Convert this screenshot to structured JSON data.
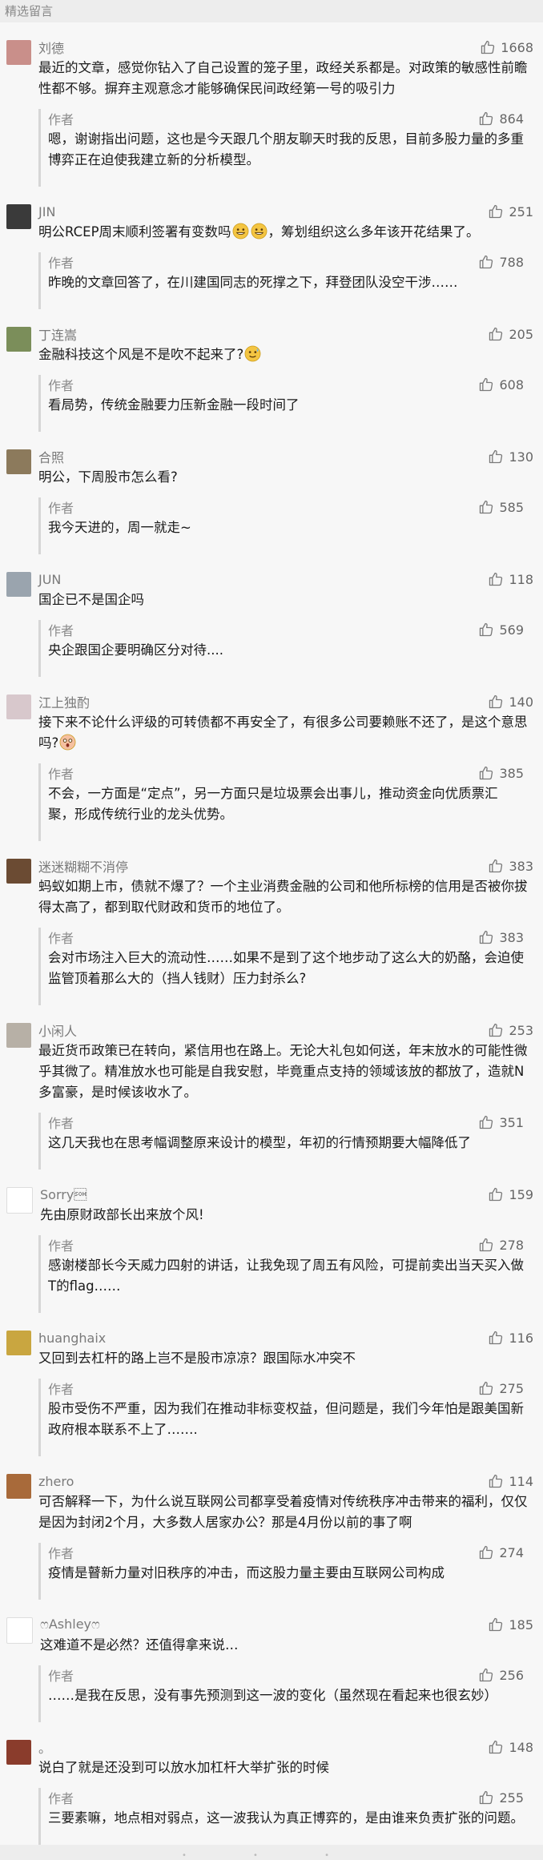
{
  "section_title": "精选留言",
  "comments": [
    {
      "nick": "刘德",
      "likes": "1668",
      "text": "最近的文章，感觉你钻入了自己设置的笼子里，政经关系都是。对政策的敏感性前瞻性都不够。摒弃主观意念才能够确保民间政经第一号的吸引力",
      "avatar_color": "#c98f8a",
      "reply": {
        "author": "作者",
        "likes": "864",
        "text": "嗯，谢谢指出问题，这也是今天跟几个朋友聊天时我的反思，目前多股力量的多重博弈正在迫使我建立新的分析模型。"
      }
    },
    {
      "nick": "JIN",
      "likes": "251",
      "text_before": "明公RCEP周末顺利签署有变数吗",
      "text_after": "，筹划组织这么多年该开花结果了。",
      "emoji": "grin-icon",
      "emoji_count": 2,
      "avatar_color": "#3a3a3a",
      "reply": {
        "author": "作者",
        "likes": "788",
        "text": "昨晚的文章回答了，在川建国同志的死撑之下，拜登团队没空干涉……"
      }
    },
    {
      "nick": "丁连嵩",
      "likes": "205",
      "text_before": "金融科技这个风是不是吹不起来了?",
      "text_after": "",
      "emoji": "sweat-icon",
      "emoji_count": 1,
      "avatar_color": "#7b8e5a",
      "reply": {
        "author": "作者",
        "likes": "608",
        "text": "看局势，传统金融要力压新金融一段时间了"
      }
    },
    {
      "nick": "合照",
      "likes": "130",
      "text": "明公，下周股市怎么看?",
      "avatar_color": "#8c7a5c",
      "reply": {
        "author": "作者",
        "likes": "585",
        "text": "我今天进的，周一就走~"
      }
    },
    {
      "nick": "JUN",
      "likes": "118",
      "text": "国企已不是国企吗",
      "avatar_color": "#9aa4ae",
      "reply": {
        "author": "作者",
        "likes": "569",
        "text": "央企跟国企要明确区分对待...."
      }
    },
    {
      "nick": "江上独酌",
      "likes": "140",
      "text_before": "接下来不论什么评级的可转债都不再安全了，有很多公司要赖账不还了，是这个意思吗?",
      "text_after": "",
      "emoji": "shocked-icon",
      "emoji_count": 1,
      "avatar_color": "#d8c8cc",
      "reply": {
        "author": "作者",
        "likes": "385",
        "text": "不会，一方面是“定点”，另一方面只是垃圾票会出事儿，推动资金向优质票汇聚，形成传统行业的龙头优势。"
      }
    },
    {
      "nick": "迷迷糊糊不消停",
      "likes": "383",
      "text": "蚂蚁如期上市，债就不爆了？一个主业消费金融的公司和他所标榜的信用是否被你拔得太高了，都到取代财政和货币的地位了。",
      "avatar_color": "#6b4b33",
      "reply": {
        "author": "作者",
        "likes": "383",
        "text": "会对市场注入巨大的流动性……如果不是到了这个地步动了这么大的奶酪，会迫使监管顶着那么大的（挡人钱财）压力封杀么?"
      }
    },
    {
      "nick": "小闲人",
      "likes": "253",
      "text": "最近货币政策已在转向，紧信用也在路上。无论大礼包如何送，年末放水的可能性微乎其微了。精准放水也可能是自我安慰，毕竟重点支持的领域该放的都放了，造就N多富豪，是时候该收水了。",
      "avatar_color": "#b7b0a6",
      "reply": {
        "author": "作者",
        "likes": "351",
        "text": "这几天我也在思考幅调整原来设计的模型，年初的行情预期要大幅降低了"
      }
    },
    {
      "nick": "Sorry\u0001",
      "likes": "159",
      "text": "先由原财政部长出来放个风!",
      "avatar_color": "#ffffff",
      "reply": {
        "author": "作者",
        "likes": "278",
        "text": "感谢楼部长今天威力四射的讲话，让我免现了周五有风险，可提前卖出当天买入做T的flag……"
      }
    },
    {
      "nick": "huanghaix",
      "likes": "116",
      "text": "又回到去杠杆的路上岂不是股市凉凉？跟国际水冲突不",
      "avatar_color": "#c9a640",
      "reply": {
        "author": "作者",
        "likes": "275",
        "text": "股市受伤不严重，因为我们在推动非标变权益，但问题是，我们今年怕是跟美国新政府根本联系不上了……."
      }
    },
    {
      "nick": "zhero",
      "likes": "114",
      "text": "可否解释一下，为什么说互联网公司都享受着疫情对传统秩序冲击带来的福利，仅仅是因为封闭2个月，大多数人居家办公？那是4月份以前的事了啊",
      "avatar_color": "#a86a3a",
      "reply": {
        "author": "作者",
        "likes": "274",
        "text": "疫情是瞽新力量对旧秩序的冲击，而这股力量主要由互联网公司构成"
      }
    },
    {
      "nick": "ෆAshleyෆ",
      "likes": "185",
      "text": "这难道不是必然？还值得拿来说…",
      "avatar_color": "#ffffff",
      "reply": {
        "author": "作者",
        "likes": "256",
        "text": "……是我在反思，没有事先预测到这一波的变化（虽然现在看起来也很玄妙）"
      }
    },
    {
      "nick": "。",
      "likes": "148",
      "text": "说白了就是还没到可以放水加杠杆大举扩张的时候",
      "avatar_color": "#8a3c2c",
      "reply": {
        "author": "作者",
        "likes": "255",
        "text": "三要素嘛，地点相对弱点，这一波我认为真正博弈的，是由谁来负责扩张的问题。"
      }
    }
  ],
  "colors": {
    "background": "#ededed",
    "list_bg": "#f7f7f7",
    "text": "#1a1a1a",
    "meta": "#888888",
    "reply_bar": "#d6d6d6"
  }
}
